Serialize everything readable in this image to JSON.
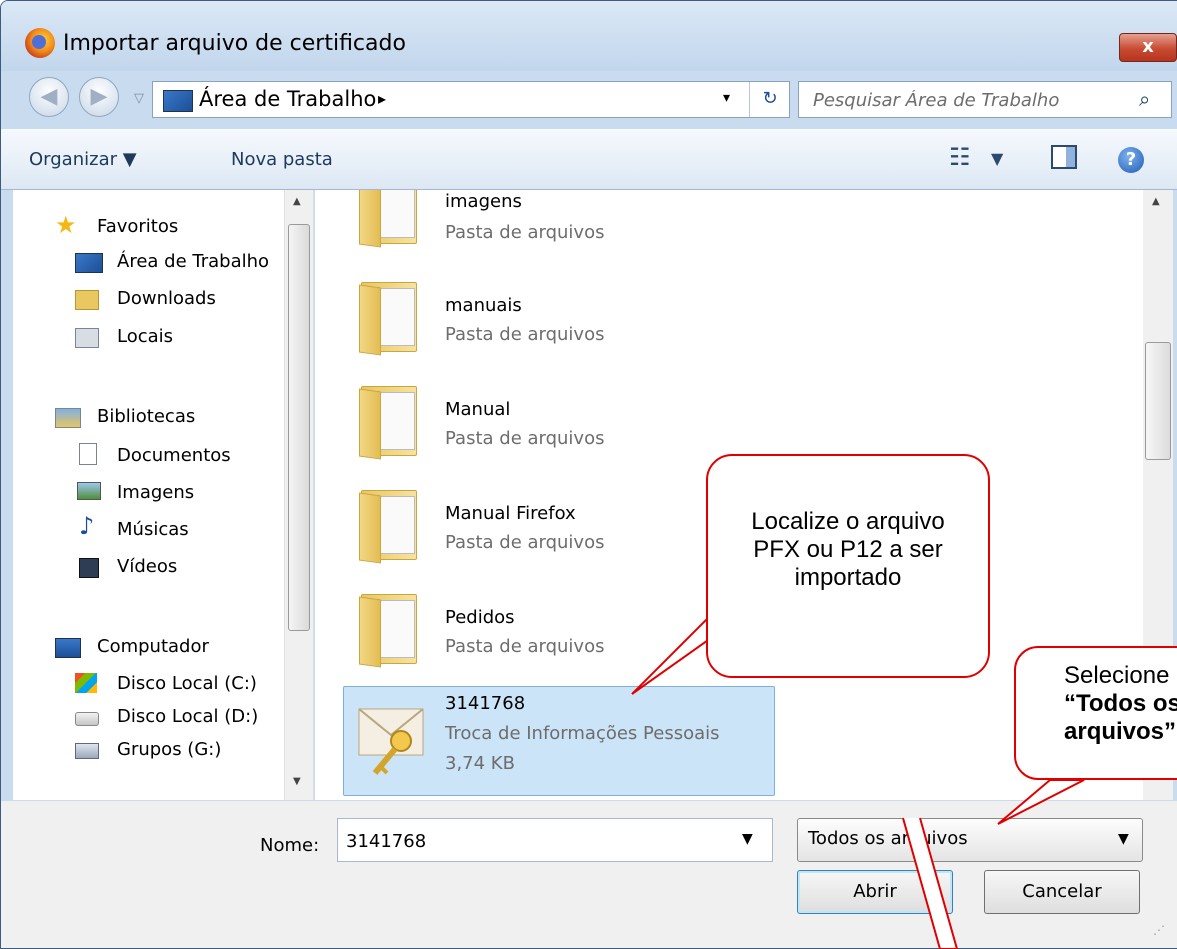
{
  "window": {
    "title": "Importar arquivo de certificado",
    "close_glyph": "x"
  },
  "address": {
    "location": "Área de Trabalho",
    "separator": "▸",
    "dropdown": "▾",
    "refresh": "↻"
  },
  "search": {
    "placeholder": "Pesquisar Área de Trabalho"
  },
  "toolbar": {
    "organize": "Organizar ▼",
    "new_folder": "Nova pasta",
    "view_dropdown": "▼"
  },
  "nav": {
    "favorites": "Favoritos",
    "fav_items": [
      "Área de Trabalho",
      "Downloads",
      "Locais"
    ],
    "libraries": "Bibliotecas",
    "lib_items": [
      "Documentos",
      "Imagens",
      "Músicas",
      "Vídeos"
    ],
    "computer": "Computador",
    "comp_items": [
      "Disco Local (C:)",
      "Disco Local (D:)",
      "Grupos (G:)"
    ]
  },
  "files": [
    {
      "name": "imagens",
      "type": "Pasta de arquivos"
    },
    {
      "name": "manuais",
      "type": "Pasta de arquivos"
    },
    {
      "name": "Manual",
      "type": "Pasta de arquivos"
    },
    {
      "name": "Manual Firefox",
      "type": "Pasta de arquivos"
    },
    {
      "name": "Pedidos",
      "type": "Pasta de arquivos"
    },
    {
      "name": "3141768",
      "type": "Troca de Informações Pessoais",
      "size": "3,74 KB",
      "selected": true
    }
  ],
  "bottom": {
    "name_label": "Nome:",
    "name_value": "3141768",
    "filetype": "Todos os arquivos",
    "open": "Abrir",
    "cancel": "Cancelar"
  },
  "callouts": {
    "locate": "Localize o arquivo PFX ou P12 a ser importado",
    "select_prefix": "Selecione",
    "select_bold": "“Todos os arquivos”"
  },
  "colors": {
    "callout_border": "#e00000",
    "selection": "#cce4f7"
  }
}
